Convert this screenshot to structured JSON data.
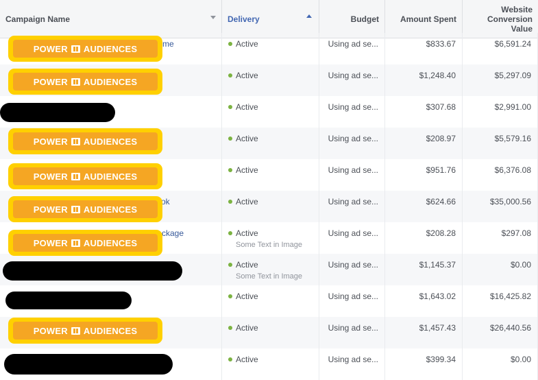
{
  "header": {
    "campaign_name": "Campaign Name",
    "delivery": "Delivery",
    "budget": "Budget",
    "amount_spent": "Amount Spent",
    "website_conversion_value": "Website Conversion Value"
  },
  "badge": {
    "left_text": "POWER",
    "right_text": "AUDIENCES"
  },
  "colors": {
    "badge_outer": "#ffd000",
    "badge_inner": "#f5a623",
    "active_dot": "#7cb342",
    "link": "#365899"
  },
  "rows": [
    {
      "name_visible": "me",
      "delivery": "Active",
      "delivery_sub": "",
      "budget": "Using ad se...",
      "spent": "$833.67",
      "value": "$6,591.24"
    },
    {
      "name_visible": "",
      "delivery": "Active",
      "delivery_sub": "",
      "budget": "Using ad se...",
      "spent": "$1,248.40",
      "value": "$5,297.09"
    },
    {
      "name_visible": "",
      "delivery": "Active",
      "delivery_sub": "",
      "budget": "Using ad se...",
      "spent": "$307.68",
      "value": "$2,991.00"
    },
    {
      "name_visible": "",
      "delivery": "Active",
      "delivery_sub": "",
      "budget": "Using ad se...",
      "spent": "$208.97",
      "value": "$5,579.16"
    },
    {
      "name_visible": "",
      "delivery": "Active",
      "delivery_sub": "",
      "budget": "Using ad se...",
      "spent": "$951.76",
      "value": "$6,376.08"
    },
    {
      "name_visible": "ok",
      "delivery": "Active",
      "delivery_sub": "",
      "budget": "Using ad se...",
      "spent": "$624.66",
      "value": "$35,000.56"
    },
    {
      "name_visible": "ckage",
      "delivery": "Active",
      "delivery_sub": "Some Text in Image",
      "budget": "Using ad se...",
      "spent": "$208.28",
      "value": "$297.08"
    },
    {
      "name_visible": "",
      "delivery": "Active",
      "delivery_sub": "Some Text in Image",
      "budget": "Using ad se...",
      "spent": "$1,145.37",
      "value": "$0.00"
    },
    {
      "name_visible": "",
      "delivery": "Active",
      "delivery_sub": "",
      "budget": "Using ad se...",
      "spent": "$1,643.02",
      "value": "$16,425.82"
    },
    {
      "name_visible": "",
      "delivery": "Active",
      "delivery_sub": "",
      "budget": "Using ad se...",
      "spent": "$1,457.43",
      "value": "$26,440.56"
    },
    {
      "name_visible": "",
      "delivery": "Active",
      "delivery_sub": "",
      "budget": "Using ad se...",
      "spent": "$399.34",
      "value": "$0.00"
    }
  ]
}
